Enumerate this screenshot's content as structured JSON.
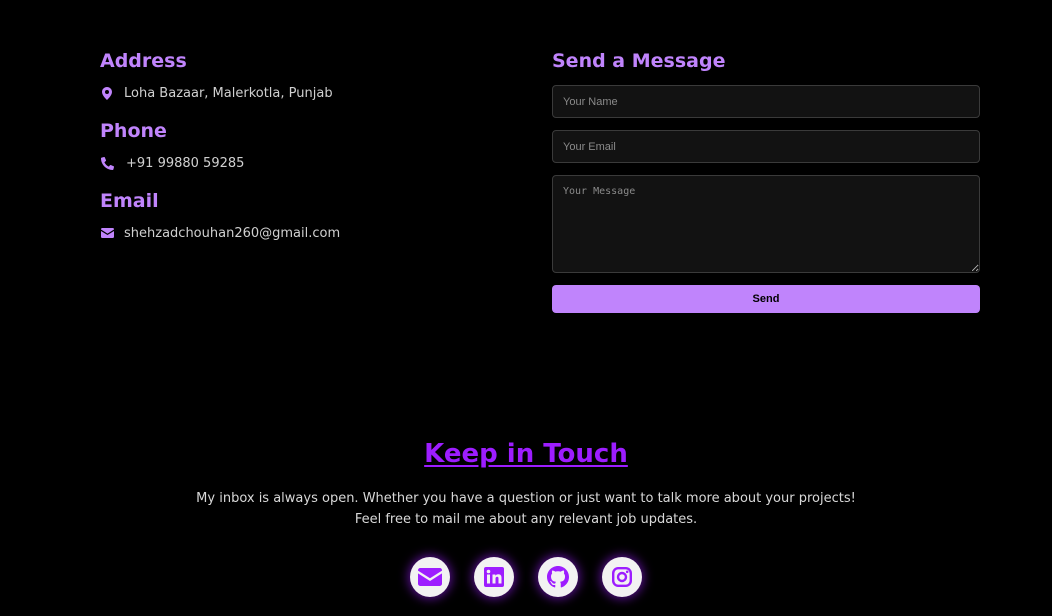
{
  "contact": {
    "address": {
      "heading": "Address",
      "value": "Loha Bazaar, Malerkotla, Punjab",
      "icon": "map-pin-icon"
    },
    "phone": {
      "heading": "Phone",
      "value": "+91 99880 59285",
      "icon": "phone-icon"
    },
    "email": {
      "heading": "Email",
      "value": "shehzadchouhan260@gmail.com",
      "icon": "envelope-icon"
    }
  },
  "form": {
    "heading": "Send a Message",
    "name_placeholder": "Your Name",
    "email_placeholder": "Your Email",
    "message_placeholder": "Your Message",
    "send_label": "Send"
  },
  "touch": {
    "heading": "Keep in Touch",
    "line1": "My inbox is always open. Whether you have a question or just want to talk more about your projects!",
    "line2": "Feel free to mail me about any relevant job updates."
  },
  "socials": [
    {
      "icon": "envelope-icon"
    },
    {
      "icon": "linkedin-icon"
    },
    {
      "icon": "github-icon"
    },
    {
      "icon": "instagram-icon"
    }
  ],
  "colors": {
    "accent": "#c084fc",
    "accent_dark": "#9d1dff",
    "background": "#000000",
    "field_bg": "#121212"
  }
}
